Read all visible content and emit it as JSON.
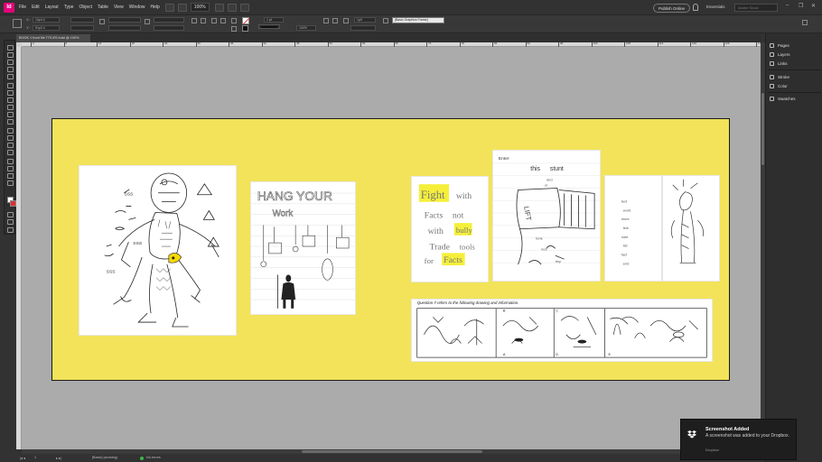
{
  "menubar": {
    "app_logo": "Id",
    "menus": [
      "File",
      "Edit",
      "Layout",
      "Type",
      "Object",
      "Table",
      "View",
      "Window",
      "Help"
    ],
    "zoom": "100%",
    "publish_label": "Publish Online",
    "workspace_label": "Essentials",
    "search_placeholder": "Adobe Stock",
    "window_controls": [
      "–",
      "❐",
      "✕"
    ]
  },
  "controlbar": {
    "x_value": "10p4.4",
    "y_value": "51p2.4",
    "stroke_weight": "1 pt",
    "scale_value": "100%",
    "dimension_value": "1p0",
    "frame_style": "[Basic Graphics Frame]"
  },
  "document": {
    "tab_label": "BOOK 1 front file TITLES.indd @ 100%",
    "ruler_labels": [
      "0",
      "6",
      "12",
      "18",
      "24",
      "30",
      "36",
      "42",
      "48",
      "54",
      "60",
      "66",
      "72",
      "78",
      "84",
      "90",
      "96",
      "102",
      "108",
      "114",
      "120",
      "126",
      "132"
    ]
  },
  "canvas": {
    "page_color": "#f2e35a",
    "pasteboard_color": "#ababab",
    "drawings": {
      "hang_your_work": [
        "HANG YOUR",
        "Work"
      ],
      "fight_with_facts": [
        "Fight",
        "with",
        "Facts",
        "not",
        "with",
        "bully",
        "Trade",
        "tools",
        "for",
        "Facts"
      ],
      "lift_note": [
        "Enter",
        "this",
        "stunt",
        "LIFT"
      ],
      "question_caption": "Question 7 refers to the following drawing and information.",
      "strip_letters": [
        "A",
        "B",
        "C",
        "D",
        "E"
      ]
    }
  },
  "statusbar": {
    "page_number": "1",
    "master_label": "[Basic] (working)",
    "preflight_label": "No errors"
  },
  "panels": [
    {
      "label": "Pages",
      "icon": "pages-icon"
    },
    {
      "label": "Layers",
      "icon": "layers-icon"
    },
    {
      "label": "Links",
      "icon": "links-icon"
    },
    {
      "label": "Stroke",
      "icon": "stroke-icon"
    },
    {
      "label": "Color",
      "icon": "color-icon"
    },
    {
      "label": "Swatches",
      "icon": "swatches-icon"
    }
  ],
  "toast": {
    "title": "Screenshot Added",
    "body": "A screenshot was added to your Dropbox.",
    "source": "Dropbox"
  }
}
